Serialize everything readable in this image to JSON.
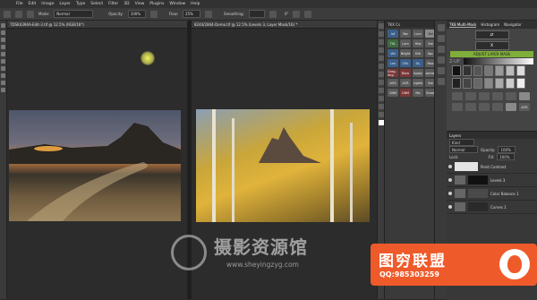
{
  "menubar": {
    "items": [
      "File",
      "Edit",
      "Image",
      "Layer",
      "Type",
      "Select",
      "Filter",
      "3D",
      "View",
      "Plugins",
      "Window",
      "Help"
    ]
  },
  "options": {
    "mode_label": "Mode:",
    "mode_value": "Normal",
    "opacity_label": "Opacity:",
    "opacity_value": "100%",
    "flow_label": "Flow:",
    "flow_value": "25%",
    "smoothing_label": "Smoothing:",
    "angle_value": "0°"
  },
  "documents": {
    "left_tab": "7DSK4394A-Edit-3.tif @ 12.5% (RGB/16*)",
    "right_tab": "8244/2844-Demo.tif @ 12.5% (Levels 3, Layer Mask/16) *"
  },
  "tkc_panel": {
    "title": "TKX Cs",
    "buttons": [
      "Inf",
      "Bw",
      "Lum",
      "Sel",
      "TXL",
      "Lum",
      "Hist",
      "Sat",
      "Vel",
      "Bright",
      "Drk",
      "Spc",
      "Lnx",
      "CHL",
      "GL",
      "Max",
      "Drag-Img",
      "Blow",
      "Apply",
      "Contrast",
      "AOS",
      "ACR",
      "Lights",
      "Sat",
      "CNM",
      "OBM",
      "Mo",
      "Show"
    ]
  },
  "tk8_panel": {
    "tabs": [
      "TK8 Multi-Mask",
      "Histogram",
      "Navigator"
    ],
    "icon_button": "⇄",
    "x_button": "X",
    "adjust_label": "ADJUST LAYER MASK",
    "z_label": "Z-UP",
    "acr_label": "ACR"
  },
  "layers_panel": {
    "title": "Layers",
    "kind_label": "Kind",
    "blend_mode": "Normal",
    "opacity_label": "Opacity:",
    "opacity_value": "100%",
    "lock_label": "Lock:",
    "fill_label": "Fill:",
    "fill_value": "100%",
    "layers": [
      {
        "name": "Point Contrast"
      },
      {
        "name": "Levels 3"
      },
      {
        "name": "Color Balance 1"
      },
      {
        "name": "Curves 1"
      }
    ]
  },
  "watermark": {
    "title": "摄影资源馆",
    "url": "www.sheyingzyg.com"
  },
  "badge": {
    "title": "图穷联盟",
    "qq": "QQ:985303259"
  },
  "colors": {
    "accent_green": "#7fae3a",
    "badge_orange": "#ef5a2a",
    "cursor_yellow": "#f1f25e"
  }
}
